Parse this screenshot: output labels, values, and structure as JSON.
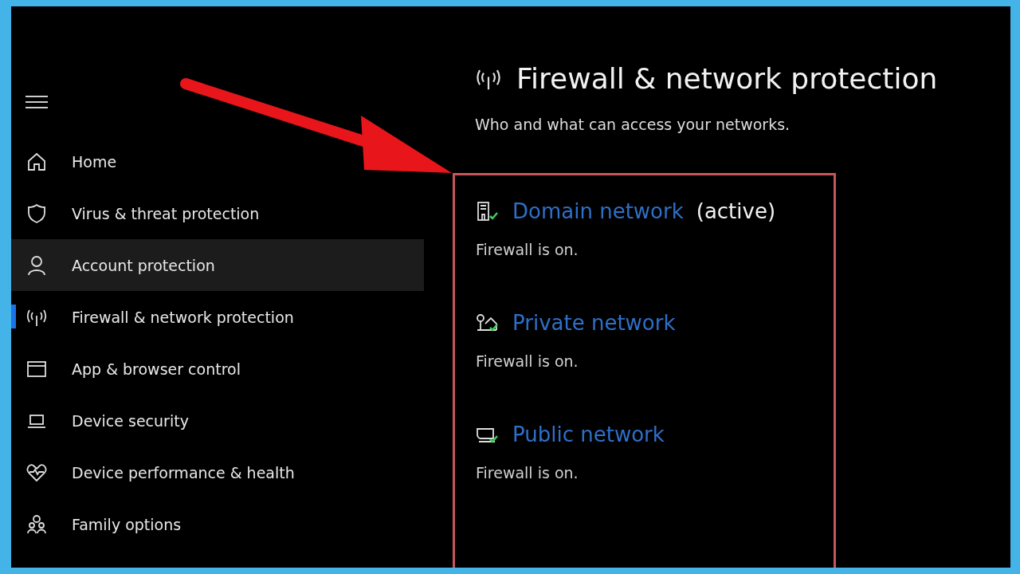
{
  "sidebar": {
    "items": [
      {
        "label": "Home",
        "kind": "home",
        "selected": false,
        "highlighted": false
      },
      {
        "label": "Virus & threat protection",
        "kind": "shield",
        "selected": false,
        "highlighted": false
      },
      {
        "label": "Account protection",
        "kind": "person",
        "selected": false,
        "highlighted": true
      },
      {
        "label": "Firewall & network protection",
        "kind": "antenna",
        "selected": true,
        "highlighted": false
      },
      {
        "label": "App & browser control",
        "kind": "window",
        "selected": false,
        "highlighted": false
      },
      {
        "label": "Device security",
        "kind": "laptop",
        "selected": false,
        "highlighted": false
      },
      {
        "label": "Device performance & health",
        "kind": "heart",
        "selected": false,
        "highlighted": false
      },
      {
        "label": "Family options",
        "kind": "family",
        "selected": false,
        "highlighted": false
      }
    ]
  },
  "page": {
    "title": "Firewall & network protection",
    "subtitle": "Who and what can access your networks."
  },
  "networks": [
    {
      "kind": "domain",
      "name": "Domain network",
      "badge": "(active)",
      "status": "Firewall is on."
    },
    {
      "kind": "private",
      "name": "Private network",
      "status": "Firewall is on."
    },
    {
      "kind": "public",
      "name": "Public network",
      "status": "Firewall is on."
    }
  ]
}
